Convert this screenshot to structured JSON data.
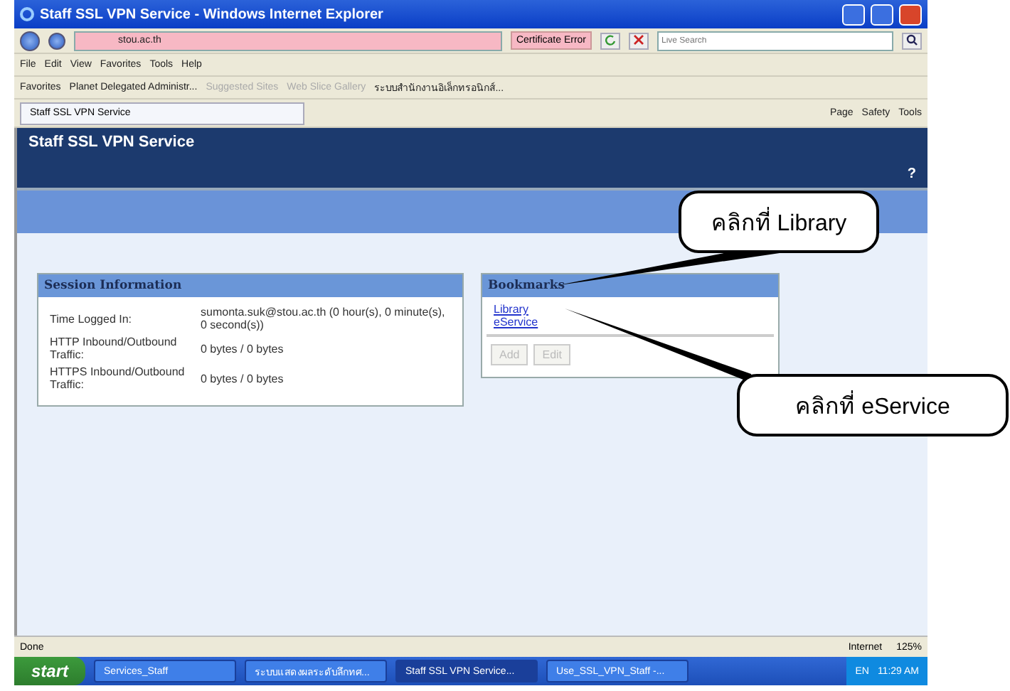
{
  "window": {
    "title": "Staff SSL VPN Service - Windows Internet Explorer"
  },
  "address_bar": {
    "url": "stou.ac.th",
    "certificate": "Certificate Error",
    "search_placeholder": "Live Search"
  },
  "menu": [
    "File",
    "Edit",
    "View",
    "Favorites",
    "Tools",
    "Help"
  ],
  "favorites_bar": [
    {
      "label": "Favorites",
      "disabled": false
    },
    {
      "label": "Planet Delegated Administr...",
      "disabled": false
    },
    {
      "label": "Suggested Sites",
      "disabled": true
    },
    {
      "label": "Web Slice Gallery",
      "disabled": true
    },
    {
      "label": "ระบบสำนักงานอิเล็กทรอนิกส์...",
      "disabled": false
    }
  ],
  "tab": {
    "label": "Staff SSL VPN Service"
  },
  "command_bar": [
    "Page",
    "Safety",
    "Tools"
  ],
  "page": {
    "header": "Staff SSL VPN Service",
    "header_icons": [
      "?"
    ],
    "session": {
      "title": "Session Information",
      "rows": [
        {
          "label": "Time Logged In:",
          "value": "sumonta.suk@stou.ac.th (0 hour(s), 0 minute(s), 0 second(s))"
        },
        {
          "label": "HTTP Inbound/Outbound Traffic:",
          "value": "0 bytes / 0 bytes"
        },
        {
          "label": "HTTPS Inbound/Outbound Traffic:",
          "value": "0 bytes / 0 bytes"
        }
      ]
    },
    "bookmarks": {
      "title": "Bookmarks",
      "links": [
        "Library",
        "eService"
      ],
      "buttons": [
        {
          "label": "Add",
          "disabled": true
        },
        {
          "label": "Edit",
          "disabled": true
        }
      ]
    }
  },
  "callouts": [
    {
      "text": "คลิกที่ Library"
    },
    {
      "text": "คลิกที่ eService"
    }
  ],
  "status_bar": {
    "text": "Done",
    "zone": "Internet",
    "zoom": "125%"
  },
  "taskbar": {
    "start": "start",
    "items": [
      {
        "label": "Services_Staff",
        "selected": false
      },
      {
        "label": "ระบบแสดงผลระดับลึกทศ...",
        "selected": false
      },
      {
        "label": "Staff SSL VPN Service...",
        "selected": true
      },
      {
        "label": "Use_SSL_VPN_Staff -...",
        "selected": false
      }
    ],
    "language": "EN",
    "time": "11:29 AM"
  }
}
